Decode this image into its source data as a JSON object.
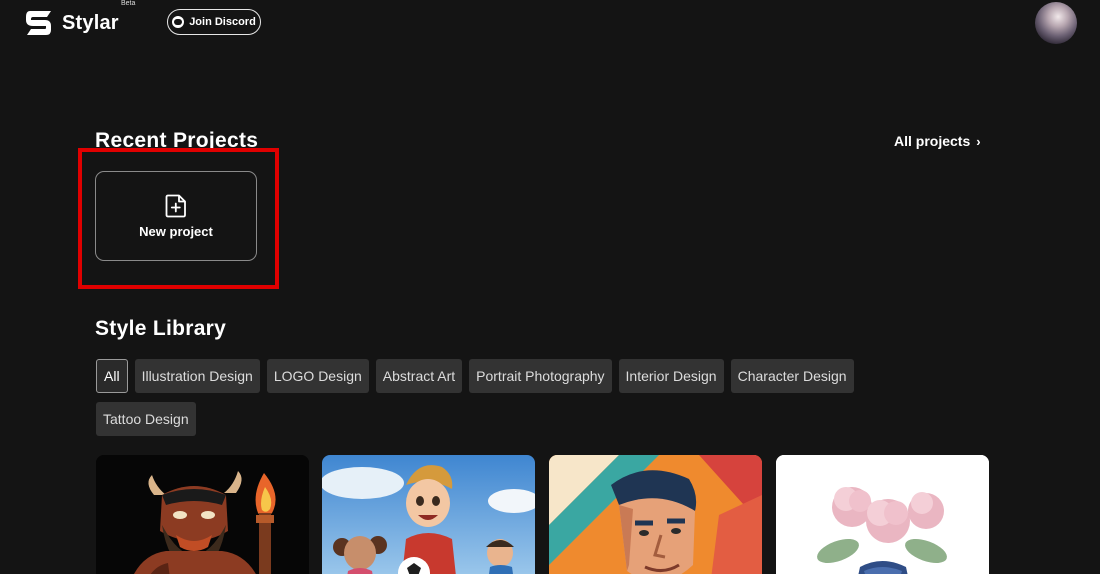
{
  "header": {
    "brand": "Stylar",
    "beta_label": "Beta",
    "discord_label": "Join Discord"
  },
  "recent": {
    "title": "Recent Projects",
    "all_projects_label": "All projects",
    "new_project_label": "New project"
  },
  "library": {
    "title": "Style Library",
    "categories": [
      {
        "label": "All",
        "active": true
      },
      {
        "label": "Illustration Design"
      },
      {
        "label": "LOGO Design"
      },
      {
        "label": "Abstract Art"
      },
      {
        "label": "Portrait Photography"
      },
      {
        "label": "Interior Design"
      },
      {
        "label": "Character Design"
      },
      {
        "label": "Tattoo Design"
      }
    ],
    "cards": [
      {
        "subject": "horned-warrior-with-torch-illustration"
      },
      {
        "subject": "cartoon-kids-playing-soccer"
      },
      {
        "subject": "geometric-man-portrait"
      },
      {
        "subject": "pink-flowers-in-blue-vase"
      }
    ]
  },
  "colors": {
    "background": "#141414",
    "chip": "#333333",
    "highlight": "#e00000"
  }
}
